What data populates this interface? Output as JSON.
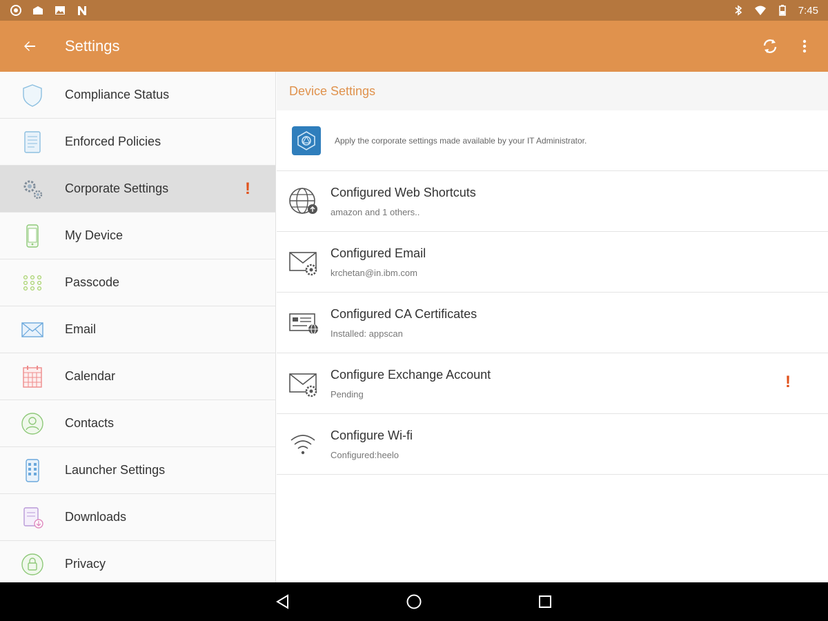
{
  "status_bar": {
    "time": "7:45",
    "left_icons": [
      "camera-icon",
      "mail-icon",
      "image-icon",
      "n-icon"
    ],
    "right_icons": [
      "bluetooth-icon",
      "wifi-icon",
      "battery-icon"
    ]
  },
  "action_bar": {
    "title": "Settings",
    "actions": [
      "sync-icon",
      "more-vert-icon"
    ]
  },
  "sidebar": {
    "items": [
      {
        "label": "Compliance Status",
        "icon": "shield-icon"
      },
      {
        "label": "Enforced Policies",
        "icon": "document-icon"
      },
      {
        "label": "Corporate Settings",
        "icon": "gears-icon",
        "active": true,
        "alert": "!"
      },
      {
        "label": "My Device",
        "icon": "phone-icon"
      },
      {
        "label": "Passcode",
        "icon": "keypad-icon"
      },
      {
        "label": "Email",
        "icon": "envelope-icon"
      },
      {
        "label": "Calendar",
        "icon": "calendar-icon"
      },
      {
        "label": "Contacts",
        "icon": "contact-icon"
      },
      {
        "label": "Launcher Settings",
        "icon": "launcher-icon"
      },
      {
        "label": "Downloads",
        "icon": "download-icon"
      },
      {
        "label": "Privacy",
        "icon": "lock-icon"
      }
    ]
  },
  "main": {
    "section_title": "Device Settings",
    "description": "Apply the corporate settings made available by your IT Administrator.",
    "rows": [
      {
        "title": "Configured Web Shortcuts",
        "subtitle": "amazon and 1 others..",
        "icon": "globe-icon"
      },
      {
        "title": "Configured Email",
        "subtitle": "krchetan@in.ibm.com",
        "icon": "mail-gear-icon"
      },
      {
        "title": "Configured CA Certificates",
        "subtitle": "Installed: appscan",
        "icon": "certificate-icon"
      },
      {
        "title": "Configure Exchange Account",
        "subtitle": "Pending",
        "icon": "mail-gear-icon",
        "alert": "!"
      },
      {
        "title": "Configure Wi-fi",
        "subtitle": "Configured:heelo",
        "icon": "wifi-icon"
      }
    ]
  },
  "colors": {
    "status_bar": "#b5773e",
    "action_bar": "#e0924d",
    "alert": "#e0521c",
    "section_title": "#e0924d"
  }
}
